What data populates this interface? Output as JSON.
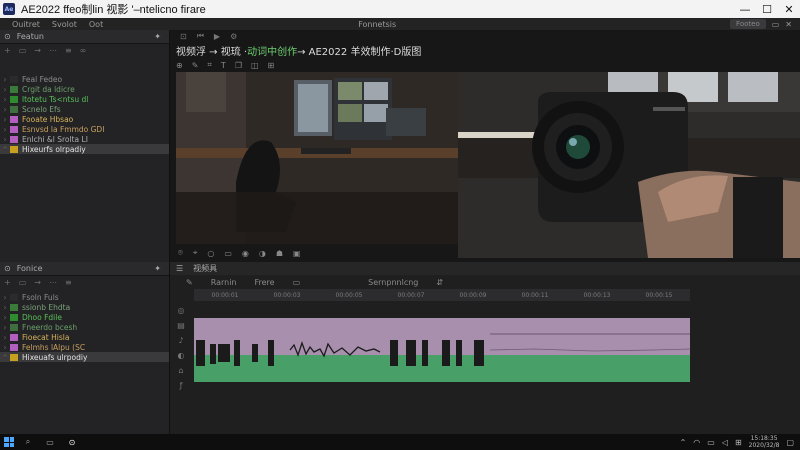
{
  "window": {
    "title": "AE2022 ffeo制lin 视影 '–ntelicno firare",
    "logo": "Ae",
    "minimize": "—",
    "maximize": "☐",
    "close": "✕"
  },
  "menubar": {
    "items": [
      "Ouitret",
      "Svolot",
      "Oot"
    ],
    "center": "Fonnetsis",
    "right_pill": "Footeo",
    "right_icons": [
      "▭",
      "✕"
    ]
  },
  "panel_top": {
    "tab": "Featun",
    "rows": [
      {
        "label": "Feal Fedeo",
        "color": "#8c8c8c",
        "icon": "#2b2b2b"
      },
      {
        "label": "Crgit da ldicre",
        "color": "#6aa06a",
        "icon": "#3a7a3a"
      },
      {
        "label": "ltotetu Ts<ntsu dl",
        "color": "#58c058",
        "icon": "#2e8c2e"
      },
      {
        "label": "Scnelo Efs",
        "color": "#7aa07a",
        "icon": "#3f6f3f"
      },
      {
        "label": "Fooate Hbsao",
        "color": "#d7b35a",
        "icon": "#b35fbf"
      },
      {
        "label": "Esnvsd la Fmmdo GDI",
        "color": "#c8a060",
        "icon": "#b35fbf"
      },
      {
        "label": "Enlchi &l Srolta LI",
        "color": "#b0b0b0",
        "icon": "#b35fbf"
      },
      {
        "label": "Hixeurfs olrpadiy",
        "color": "#e3e3e3",
        "icon": "#c8a020"
      }
    ]
  },
  "panel_bottom": {
    "tab": "Fonice",
    "rows": [
      {
        "label": "Fsoln Fuls",
        "color": "#8c8c8c",
        "icon": "#2b2b2b"
      },
      {
        "label": "ssionb Ehdta",
        "color": "#7aa07a",
        "icon": "#3a7a3a"
      },
      {
        "label": "Dhoo Fdile",
        "color": "#58c058",
        "icon": "#2e8c2e"
      },
      {
        "label": "Fneerdo bcesh",
        "color": "#6aa06a",
        "icon": "#3f6f3f"
      },
      {
        "label": "Fioecat Hisla",
        "color": "#d7b35a",
        "icon": "#b35fbf"
      },
      {
        "label": "Felmhs lAlpu (SC",
        "color": "#c8a060",
        "icon": "#b35fbf"
      },
      {
        "label": "Hixeuafs ulrpodiy",
        "color": "#e3e3e3",
        "icon": "#c8a020"
      }
    ]
  },
  "viewer": {
    "caption_prefix": "视频浮 → 视琉 · ",
    "caption_green": "动词中创作",
    "caption_suffix": " → AE2022 羊效制作·D版图",
    "tools": [
      "▢",
      "◐",
      "❚❚",
      "▭",
      "⌑",
      "▥"
    ]
  },
  "timeline": {
    "tab": "视频具",
    "labels": [
      "Rarnin",
      "Frere",
      "Sernpnnlcng"
    ],
    "ruler": [
      "00:00:01",
      "00:00:03",
      "00:00:05",
      "00:00:07",
      "00:00:09",
      "00:00:11",
      "00:00:13",
      "00:00:15"
    ]
  },
  "taskbar": {
    "time": "15:18:35",
    "date": "2020/32/8"
  }
}
